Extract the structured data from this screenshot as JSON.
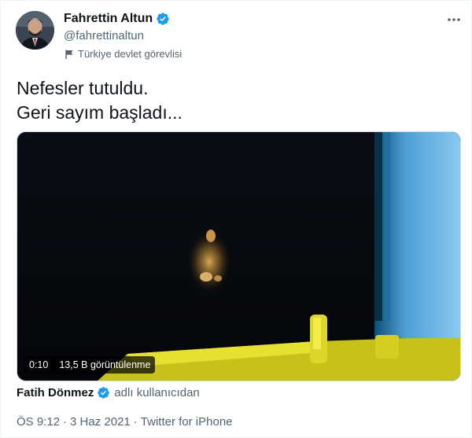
{
  "author": {
    "name": "Fahrettin Altun",
    "handle": "@fahrettinaltun",
    "label": "Türkiye devlet görevlisi"
  },
  "tweet": {
    "lines": [
      "Nefesler tutuldu.",
      "Geri sayım başladı..."
    ]
  },
  "video": {
    "duration": "0:10",
    "views": "13,5 B görüntülenme"
  },
  "attribution": {
    "name": "Fatih Dönmez",
    "suffix": "adlı kullanıcıdan"
  },
  "meta": {
    "time": "ÖS 9:12",
    "date": "3 Haz 2021",
    "source": "Twitter for iPhone",
    "separator": "·"
  },
  "icons": {
    "verified": "verified-badge-icon",
    "label": "government-flag-icon",
    "more": "more-options-icon"
  },
  "colors": {
    "verified": "#1d9bf0",
    "secondary_text": "#536471",
    "primary_text": "#0f1419"
  }
}
